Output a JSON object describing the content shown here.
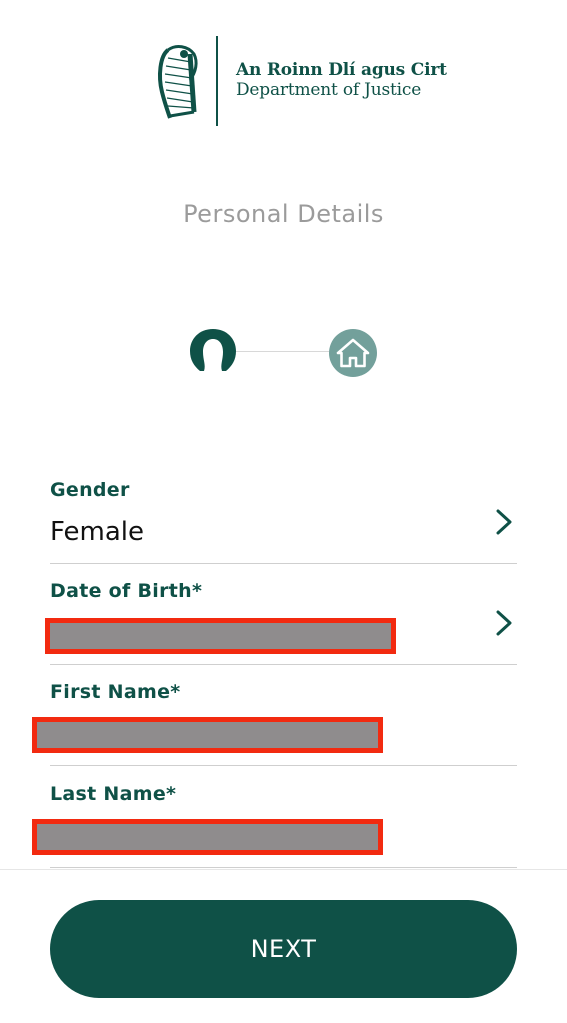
{
  "header": {
    "logo_icon": "harp-icon",
    "department_irish": "An Roinn Dlí agus Cirt",
    "department_english": "Department of Justice"
  },
  "page": {
    "title": "Personal Details"
  },
  "stepper": {
    "steps": [
      {
        "icon": "person-icon",
        "state": "active"
      },
      {
        "icon": "home-icon",
        "state": "inactive"
      }
    ]
  },
  "form": {
    "gender": {
      "label": "Gender",
      "value": "Female"
    },
    "date_of_birth": {
      "label": "Date of Birth*",
      "value": ""
    },
    "first_name": {
      "label": "First Name*",
      "value": ""
    },
    "last_name": {
      "label": "Last Name*",
      "value": ""
    }
  },
  "actions": {
    "next_label": "NEXT"
  },
  "colors": {
    "primary": "#0f5147",
    "step_inactive": "#73a09b",
    "title_gray": "#9b9b9b",
    "redaction_border": "#f22a10",
    "redaction_fill": "#8f8c8d"
  }
}
